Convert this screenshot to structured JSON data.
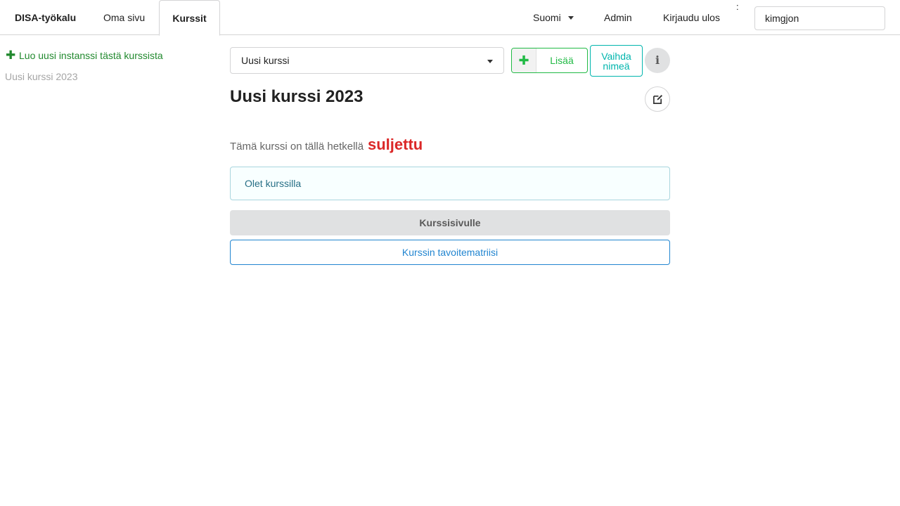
{
  "nav": {
    "brand": "DISA-työkalu",
    "own_page": "Oma sivu",
    "courses": "Kurssit",
    "language": "Suomi",
    "admin": "Admin",
    "logout": "Kirjaudu ulos",
    "separator": ":",
    "user_field_value": "kimgjon"
  },
  "sidebar": {
    "new_instance_icon": "plus-icon",
    "new_instance_label": "Luo uusi instanssi tästä kurssista",
    "instances": [
      "Uusi kurssi 2023"
    ]
  },
  "main": {
    "course_select": {
      "selected": "Uusi kurssi"
    },
    "add_button": {
      "icon": "plus-icon",
      "label": "Lisää"
    },
    "rename_button": {
      "line1": "Vaihda",
      "line2": "nimeä"
    },
    "info_button": {
      "icon": "info-icon",
      "glyph": "i"
    },
    "edit_button": {
      "icon": "edit-icon"
    },
    "course_title": "Uusi kurssi 2023",
    "status_text": "Tämä kurssi on tällä hetkellä",
    "status_value": "suljettu",
    "enrolled_message": "Olet kurssilla",
    "course_page_button": "Kurssisivulle",
    "matrix_button": "Kurssin tavoitematriisi"
  },
  "colors": {
    "green": "#21ba45",
    "dark_green": "#21892e",
    "teal": "#00b5ad",
    "red": "#db2828",
    "blue": "#2185d0",
    "info_text": "#276f86",
    "info_border": "#a9d5de",
    "info_bg": "#f8ffff",
    "grey_button": "#e0e1e2"
  }
}
